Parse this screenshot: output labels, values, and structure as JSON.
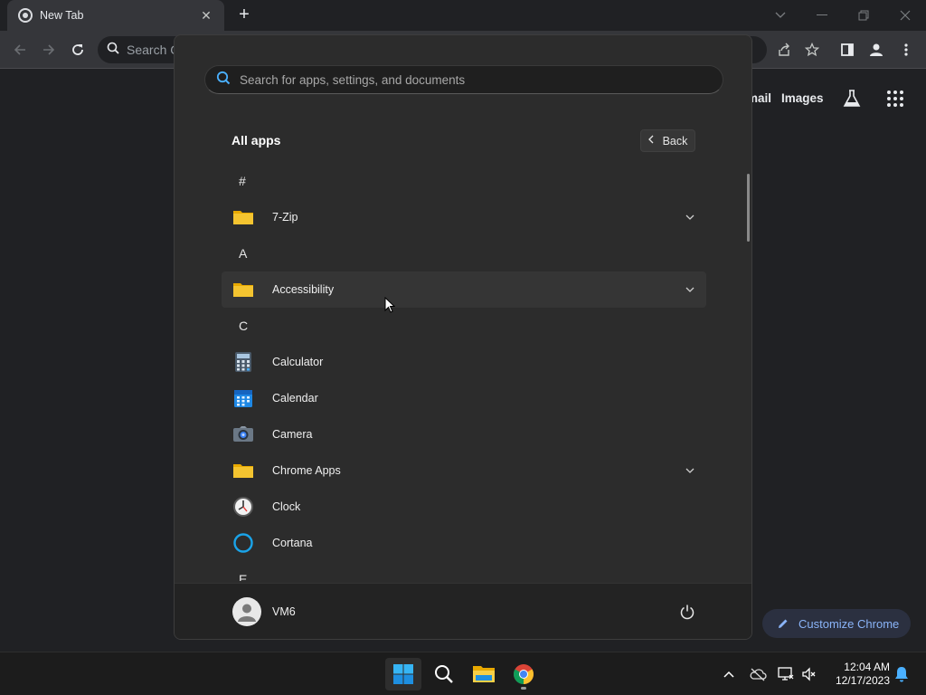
{
  "browser": {
    "tab_title": "New Tab",
    "omnibox_placeholder": "Search G",
    "ntp_links": [
      "mail",
      "Images"
    ],
    "customize_label": "Customize Chrome"
  },
  "start_menu": {
    "search_placeholder": "Search for apps, settings, and documents",
    "section_title": "All apps",
    "back_label": "Back",
    "items": [
      {
        "type": "letter",
        "label": "#"
      },
      {
        "type": "app",
        "label": "7-Zip",
        "icon": "folder-icon",
        "expandable": true
      },
      {
        "type": "letter",
        "label": "A"
      },
      {
        "type": "app",
        "label": "Accessibility",
        "icon": "folder-icon",
        "expandable": true,
        "hovered": true
      },
      {
        "type": "letter",
        "label": "C"
      },
      {
        "type": "app",
        "label": "Calculator",
        "icon": "calculator-icon",
        "expandable": false
      },
      {
        "type": "app",
        "label": "Calendar",
        "icon": "calendar-icon",
        "expandable": false
      },
      {
        "type": "app",
        "label": "Camera",
        "icon": "camera-icon",
        "expandable": false
      },
      {
        "type": "app",
        "label": "Chrome Apps",
        "icon": "folder-icon",
        "expandable": true
      },
      {
        "type": "app",
        "label": "Clock",
        "icon": "clock-icon",
        "expandable": false
      },
      {
        "type": "app",
        "label": "Cortana",
        "icon": "cortana-icon",
        "expandable": false
      },
      {
        "type": "letter",
        "label": "E"
      }
    ],
    "user_name": "VM6"
  },
  "taskbar": {
    "time": "12:04 AM",
    "date": "12/17/2023"
  },
  "colors": {
    "accent_blue": "#8ab4f8",
    "folder_yellow": "#f4c430",
    "start_bg": "#2c2c2c"
  }
}
